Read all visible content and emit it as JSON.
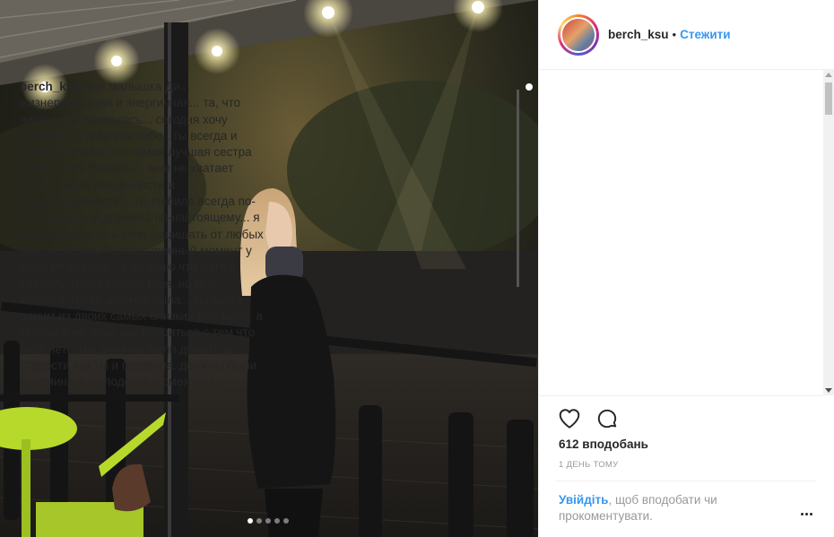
{
  "post": {
    "username": "berch_ksu",
    "separator": "•",
    "follow_label": "Стежити",
    "caption": "моя малышка Ди... жизнерадостная и энергичная... та, что никогда не сдавалась... сегодня хочу написать о тебе или тебе...ты всегда и всем говорила, что самая лучшая сестра это я, но ей была ты... мне не хватает тебя... твоей уверенности и прямолинейности... ты любила всегда по-настоящему и дружила по-настоящему... я всегда старалась тебя защищать от любых бед, но в самый ответственный момент у меня не вышло... я не знаю что могла сделать чтобы спасти тебя, но мне кажется что-то должна была... ты была одним из двоих самых близких для меня, а теперь я не знаю как смириться с тем что тебя нет... мы должны были дожить до старости как ты и говорила, должны были вспоминать молодость и смеяться, должны были отметить твою душевную",
    "likes": "612 вподобань",
    "time": "1 ДЕНЬ ТОМУ",
    "login_link": "Увійдіть",
    "login_text": ", щоб вподобати чи прокоментувати.",
    "carousel": {
      "count": 5,
      "active": 1
    }
  },
  "icons": {
    "like": "heart-icon",
    "comment": "comment-icon",
    "more": "more-options-icon"
  },
  "colors": {
    "link": "#3897f0",
    "text": "#262626",
    "muted": "#999999",
    "border": "#efefef",
    "bench": "#b6d92c"
  }
}
